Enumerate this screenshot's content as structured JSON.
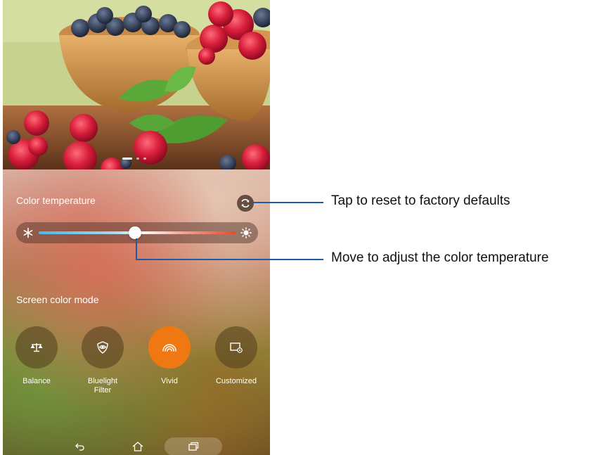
{
  "screen": {
    "color_temperature_label": "Color temperature",
    "color_temperature_level": 0.49,
    "reset_icon": "refresh-icon",
    "cold_icon": "snowflake-icon",
    "warm_icon": "sun-icon",
    "screen_color_mode_label": "Screen color mode",
    "pager": {
      "count": 3,
      "active": 0
    },
    "modes": [
      {
        "label": "Balance",
        "icon": "balance-scale-icon",
        "selected": false
      },
      {
        "label": "Bluelight\nFilter",
        "icon": "eye-shield-icon",
        "selected": false
      },
      {
        "label": "Vivid",
        "icon": "rainbow-icon",
        "selected": true
      },
      {
        "label": "Customized",
        "icon": "screen-settings-icon",
        "selected": false
      }
    ],
    "navbar": {
      "back_icon": "back-icon",
      "home_icon": "home-icon",
      "recent_icon": "recent-apps-icon"
    },
    "accent_color": "#f07812"
  },
  "callouts": {
    "reset": "Tap to reset to factory defaults",
    "slider": "Move to adjust the color temperature"
  }
}
